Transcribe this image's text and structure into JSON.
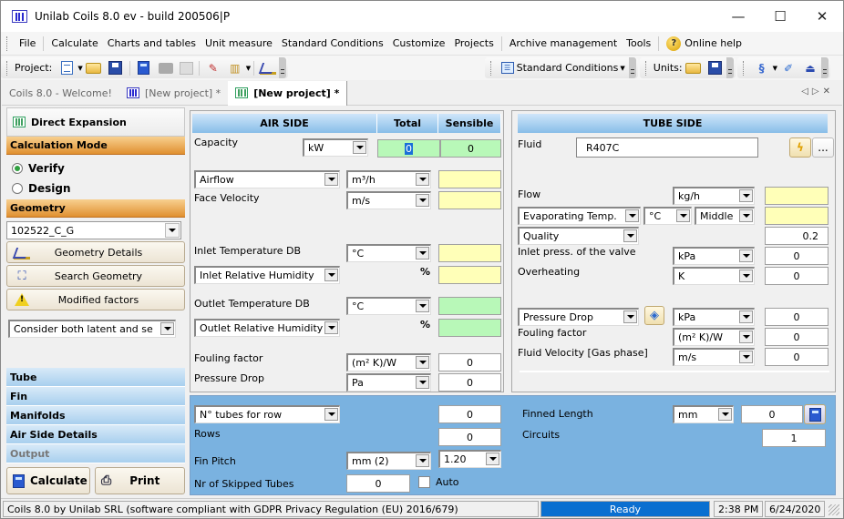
{
  "window": {
    "title": "Unilab Coils 8.0 ev - build 200506|P",
    "minimize": "—",
    "maximize": "☐",
    "close": "✕"
  },
  "menu": {
    "items": [
      "File",
      "Calculate",
      "Charts and tables",
      "Unit measure",
      "Standard Conditions",
      "Customize",
      "Projects",
      "Archive management",
      "Tools",
      "Online help"
    ]
  },
  "toolbar": {
    "project_label": "Project:",
    "standard_conditions": "Standard Conditions",
    "units_label": "Units:"
  },
  "tabs": [
    {
      "label": "Coils 8.0 - Welcome!",
      "active": false
    },
    {
      "label": "[New project] *",
      "active": false
    },
    {
      "label": "[New project] *",
      "active": true
    }
  ],
  "left_panel": {
    "header": "Direct Expansion",
    "calc_mode": {
      "title": "Calculation Mode",
      "options": [
        "Verify",
        "Design"
      ],
      "selected": "Verify"
    },
    "geometry": {
      "title": "Geometry",
      "selected": "102522_C_G",
      "buttons": [
        "Geometry Details",
        "Search Geometry",
        "Modified factors"
      ],
      "latent_option": "Consider both latent and se"
    },
    "sections": [
      "Tube",
      "Fin",
      "Manifolds",
      "Air Side Details",
      "Output"
    ],
    "calculate": "Calculate",
    "print": "Print"
  },
  "air_side": {
    "header": "AIR SIDE",
    "col_total": "Total",
    "col_sensible": "Sensible",
    "capacity": {
      "label": "Capacity",
      "unit": "kW",
      "total": "0",
      "sensible": "0"
    },
    "airflow": {
      "selector": "Airflow",
      "unit": "m³/h",
      "value": ""
    },
    "face_velocity": {
      "label": "Face Velocity",
      "unit": "m/s",
      "value": ""
    },
    "inlet_temp": {
      "label": "Inlet Temperature DB",
      "unit": "°C",
      "value": ""
    },
    "inlet_rh": {
      "selector": "Inlet Relative Humidity",
      "unit": "%",
      "value": ""
    },
    "outlet_temp": {
      "label": "Outlet Temperature DB",
      "unit": "°C",
      "value": ""
    },
    "outlet_rh": {
      "selector": "Outlet Relative Humidity",
      "unit": "%",
      "value": ""
    },
    "fouling": {
      "label": "Fouling factor",
      "unit": "(m² K)/W",
      "value": "0"
    },
    "pressure_drop": {
      "label": "Pressure Drop",
      "unit": "Pa",
      "value": "0"
    }
  },
  "tube_side": {
    "header": "TUBE SIDE",
    "fluid": {
      "label": "Fluid",
      "value": "R407C",
      "more": "..."
    },
    "flow": {
      "label": "Flow",
      "unit": "kg/h",
      "value": ""
    },
    "evap": {
      "selector": "Evaporating Temp.",
      "unit": "°C",
      "position": "Middle",
      "value": ""
    },
    "quality": {
      "selector": "Quality",
      "value": "0.2"
    },
    "inlet_press": {
      "label": "Inlet press. of the valve",
      "unit": "kPa",
      "value": "0"
    },
    "overheating": {
      "label": "Overheating",
      "unit": "K",
      "value": "0"
    },
    "pressure_drop": {
      "selector": "Pressure Drop",
      "unit": "kPa",
      "value": "0"
    },
    "fouling": {
      "label": "Fouling factor",
      "unit": "(m² K)/W",
      "value": "0"
    },
    "fluid_velocity": {
      "label": "Fluid Velocity [Gas phase]",
      "unit": "m/s",
      "value": "0"
    }
  },
  "geometry_panel": {
    "tubes_per_row": {
      "selector": "N° tubes for row",
      "value": "0"
    },
    "rows": {
      "label": "Rows",
      "value": "0"
    },
    "fin_pitch": {
      "label": "Fin Pitch",
      "unit": "mm (2)",
      "value": "1.20"
    },
    "skipped": {
      "label": "Nr of Skipped Tubes",
      "value": "0",
      "auto": "Auto",
      "auto_checked": false
    },
    "finned_length": {
      "label": "Finned Length",
      "unit": "mm",
      "value": "0"
    },
    "circuits": {
      "label": "Circuits",
      "value": "1"
    }
  },
  "status": {
    "message": "Coils 8.0 by Unilab SRL (software compliant with GDPR Privacy Regulation (EU) 2016/679)",
    "state": "Ready",
    "time": "2:38 PM",
    "date": "6/24/2020"
  }
}
